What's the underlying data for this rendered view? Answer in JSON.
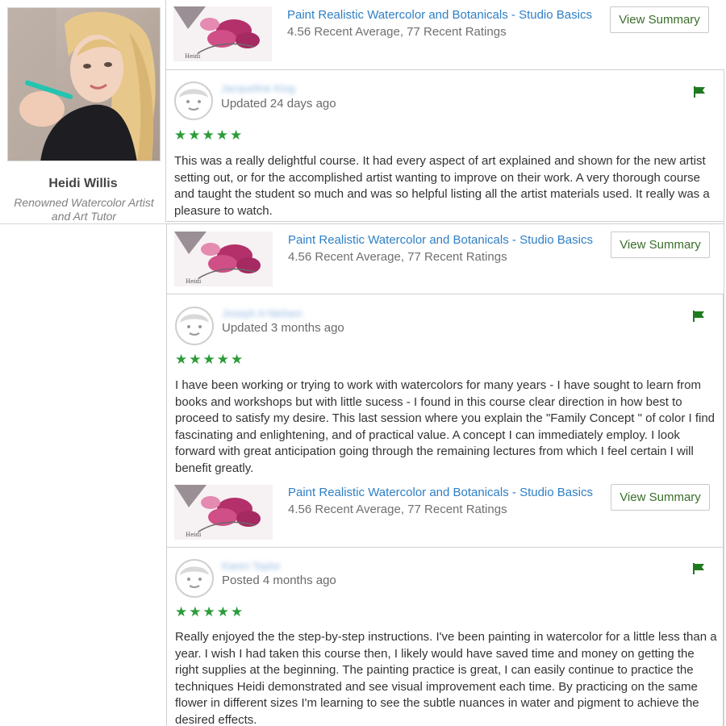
{
  "author": {
    "name": "Heidi Willis",
    "title": "Renowned Watercolor Artist and Art Tutor"
  },
  "course": {
    "title": "Paint Realistic Watercolor and Botanicals - Studio Basics",
    "rating": "4.56 Recent Average, 77 Recent Ratings",
    "button": "View Summary"
  },
  "reviews": [
    {
      "name": "Jacqueline King",
      "date": "Updated 24 days ago",
      "stars": "★★★★★",
      "text": "This was a really delightful course. It had every aspect of art explained and shown for the new artist setting out, or for the accomplished artist wanting to improve on their work. A very thorough course and taught the student so much and was so helpful listing all the artist materials used. It really was a pleasure to watch."
    },
    {
      "name": "Joseph A Nielsen",
      "date": "Updated 3 months ago",
      "stars": "★★★★★",
      "text": "I have been working or trying to work with watercolors for many years - I have sought to learn from books and workshops but with little sucess - I found in this course clear direction in how best to proceed to satisfy my desire. This last session where you explain the \"Family Concept \" of color I find fascinating and enlightening, and of practical value. A concept I can immediately employ. I look forward with great anticipation going through the remaining lectures from which I feel certain I will benefit greatly."
    },
    {
      "name": "Karen Taylor",
      "date": "Posted 4 months ago",
      "stars": "★★★★★",
      "text": "Really enjoyed the the step-by-step instructions. I've been painting in watercolor for a little less than a year. I wish I had taken this course then, I likely would have saved time and money on getting the right supplies at the beginning. The painting practice is great, I can easily continue to practice the techniques Heidi demonstrated and see visual improvement each time. By practicing on the same flower in different sizes I'm learning to see the subtle nuances in water and pigment to achieve the desired effects."
    }
  ],
  "colors": {
    "link": "#2f7fc5",
    "star": "#2d9b3a",
    "flag": "#1f7a1f",
    "button_text": "#3a6d2a"
  }
}
